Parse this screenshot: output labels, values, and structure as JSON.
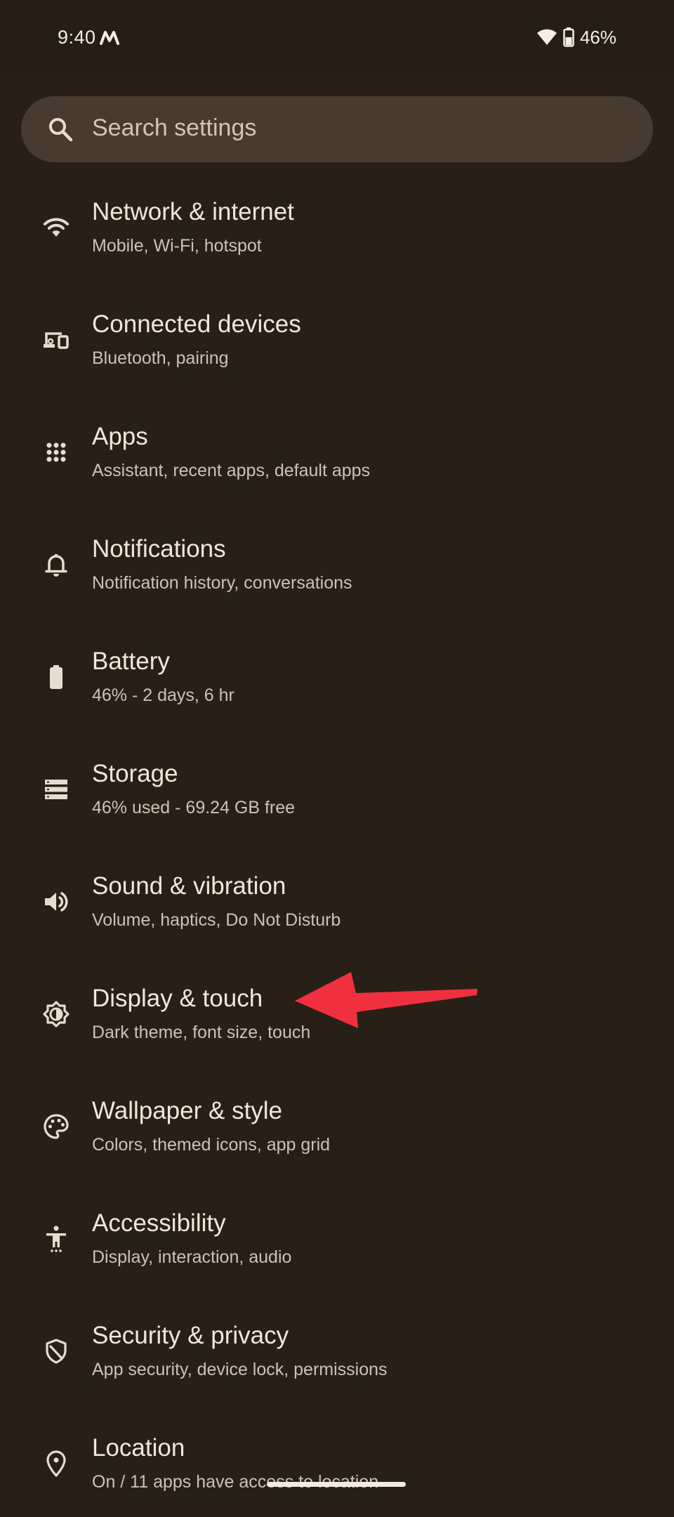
{
  "status_bar": {
    "time": "9:40",
    "battery_percent": "46%"
  },
  "search": {
    "placeholder": "Search settings"
  },
  "settings": [
    {
      "title": "Network & internet",
      "subtitle": "Mobile, Wi-Fi, hotspot",
      "icon": "wifi-icon"
    },
    {
      "title": "Connected devices",
      "subtitle": "Bluetooth, pairing",
      "icon": "devices-icon"
    },
    {
      "title": "Apps",
      "subtitle": "Assistant, recent apps, default apps",
      "icon": "apps-grid-icon"
    },
    {
      "title": "Notifications",
      "subtitle": "Notification history, conversations",
      "icon": "bell-icon"
    },
    {
      "title": "Battery",
      "subtitle": "46% - 2 days, 6 hr",
      "icon": "battery-icon"
    },
    {
      "title": "Storage",
      "subtitle": "46% used - 69.24 GB free",
      "icon": "storage-icon"
    },
    {
      "title": "Sound & vibration",
      "subtitle": "Volume, haptics, Do Not Disturb",
      "icon": "speaker-icon"
    },
    {
      "title": "Display & touch",
      "subtitle": "Dark theme, font size, touch",
      "icon": "brightness-icon"
    },
    {
      "title": "Wallpaper & style",
      "subtitle": "Colors, themed icons, app grid",
      "icon": "palette-icon"
    },
    {
      "title": "Accessibility",
      "subtitle": "Display, interaction, audio",
      "icon": "accessibility-icon"
    },
    {
      "title": "Security & privacy",
      "subtitle": "App security, device lock, permissions",
      "icon": "shield-icon"
    },
    {
      "title": "Location",
      "subtitle": "On / 11 apps have access to location",
      "icon": "location-pin-icon"
    }
  ],
  "colors": {
    "background": "#282017",
    "search_bar": "#473a30",
    "annotation_arrow": "#f0303f"
  }
}
